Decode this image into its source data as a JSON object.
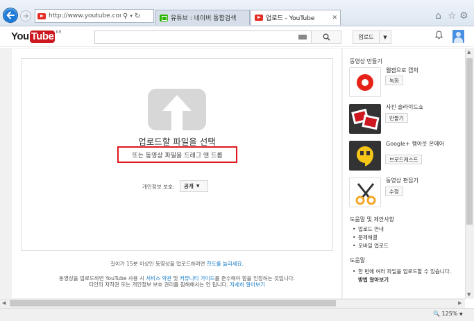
{
  "browser": {
    "address": "http://www.youtube.com/upl",
    "tabs": [
      {
        "label": "유튜브 : 네이버 통합검색"
      },
      {
        "label": "업로드 - YouTube"
      }
    ],
    "zoom": "125%"
  },
  "header": {
    "logo_you": "You",
    "logo_tube": "Tube",
    "logo_region": "KR",
    "upload_label": "업로드"
  },
  "main": {
    "upload_title": "업로드할 파일을 선택",
    "drag_text": "또는 동영상 파일을 드래그 앤 드롭",
    "privacy_label": "개인정보 보호:",
    "privacy_value": "공개",
    "length_note_prefix": "길이가 15분 이상인 동영상을 업로드하려면 ",
    "length_note_link": "한도를 늘리세요.",
    "terms_line1_a": "동영상을 업로드하면 YouTube 사용 시 ",
    "terms_link1": "서비스 약관",
    "terms_line1_b": " 및 ",
    "terms_link2": "커뮤니티 가이드",
    "terms_line1_c": "를 준수해야 함을 인정하는 것입니다.",
    "terms_line2": "타인의 저작권 또는 개인정보 보호 권리를 침해해서는 안 됩니다. ",
    "terms_link3": "자세히 알아보기"
  },
  "sidebar": {
    "create_heading": "동영상 만들기",
    "tools": [
      {
        "name": "웹캠으로 캡처",
        "button": "녹화",
        "icon": "webcam-record-icon"
      },
      {
        "name": "사진 슬라이드쇼",
        "button": "만들기",
        "icon": "photo-slideshow-icon"
      },
      {
        "name": "Google+ 행아웃 온에어",
        "button": "브로드캐스트",
        "icon": "hangouts-icon"
      },
      {
        "name": "동영상 편집기",
        "button": "수정",
        "icon": "editor-scissors-icon"
      }
    ],
    "help_heading": "도움말 및 제안사항",
    "help_links": [
      "업로드 안내",
      "문제해결",
      "모바일 업로드"
    ],
    "help2_heading": "도움말",
    "help2_text": "한 번에 여러 파일을 업로드할 수 있습니다.",
    "help2_link": "방법 알아보기"
  },
  "colors": {
    "youtube_red": "#cc181e",
    "link_blue": "#167ac6",
    "highlight_red": "#e0161e"
  }
}
